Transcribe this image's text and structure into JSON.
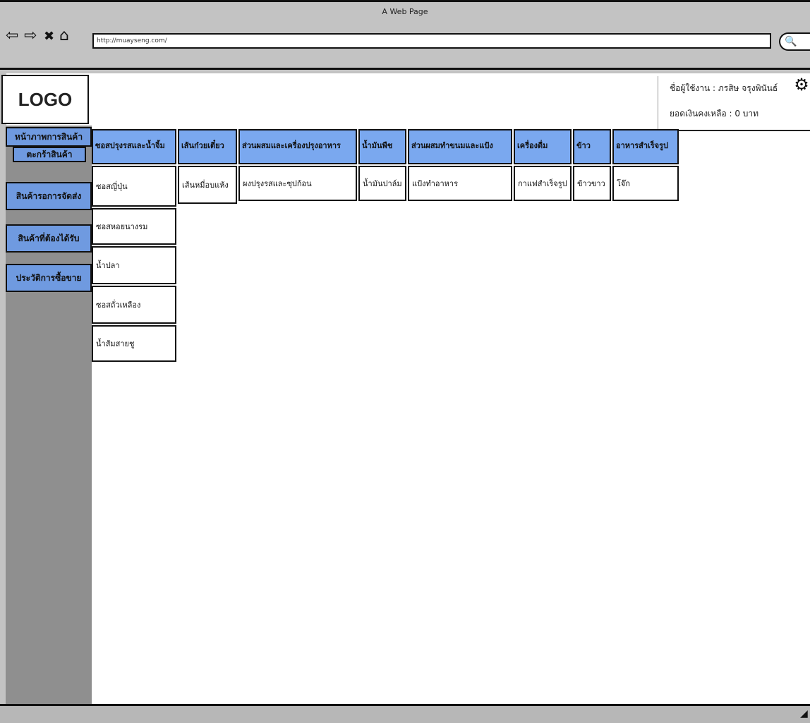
{
  "browser": {
    "window_title": "A Web Page",
    "url": "http://muayseng.com/",
    "back_icon": "⇦",
    "forward_icon": "⇨",
    "close_icon": "✖",
    "home_icon": "⌂",
    "search_icon": "🔍"
  },
  "logo": "LOGO",
  "user": {
    "username_line": "ชื่อผู้ใช้งาน : ภรสิษ จรุงพินันธ์",
    "balance_line": "ยอดเงินคงเหลือ : 0 บาท",
    "settings_icon": "⚙"
  },
  "sidebar": {
    "items": [
      {
        "label": "หน้าภาพการสินค้า"
      },
      {
        "label": "ตะกร้าสินค้า"
      },
      {
        "label": "สินค้ารอการจัดส่ง"
      },
      {
        "label": "สินค้าที่ต้องได้รับ"
      },
      {
        "label": "ประวัติการซื้อขาย"
      }
    ]
  },
  "categories": [
    {
      "label": "ซอสปรุงรสและน้ำจิ้ม",
      "items": [
        "ซอสญี่ปุ่น",
        "ซอสหอยนางรม",
        "น้ำปลา",
        "ซอสถั่วเหลือง",
        "น้ำส้มสายชู"
      ]
    },
    {
      "label": "เส้นก๋วยเตี๋ยว",
      "items": [
        "เส้นหมี่อบแห้ง"
      ]
    },
    {
      "label": "ส่วนผสมและเครื่องปรุงอาหาร",
      "items": [
        "ผงปรุงรสและซุปก้อน"
      ]
    },
    {
      "label": "น้ำมันพืช",
      "items": [
        "น้ำมันปาล์ม"
      ]
    },
    {
      "label": "ส่วนผสมทำขนมและแป้ง",
      "items": [
        "แป้งทำอาหาร"
      ]
    },
    {
      "label": "เครื่องดื่ม",
      "items": [
        "กาแฟสำเร็จรูป"
      ]
    },
    {
      "label": "ข้าว",
      "items": [
        "ข้าวขาว"
      ]
    },
    {
      "label": "อาหารสำเร็จรูป",
      "items": [
        "โจ๊ก"
      ]
    }
  ]
}
